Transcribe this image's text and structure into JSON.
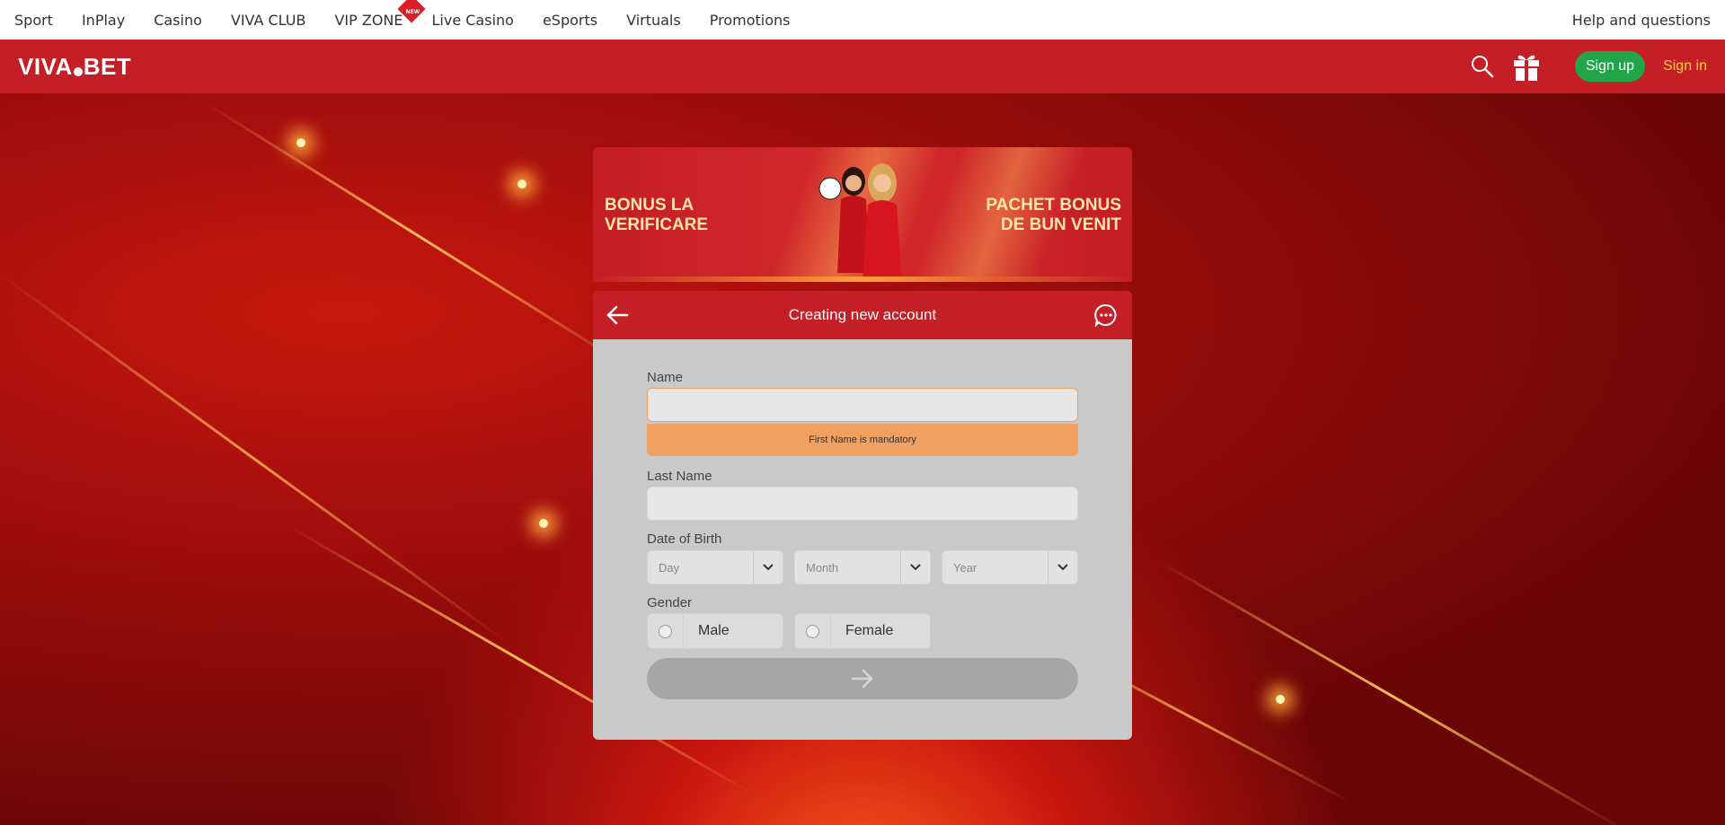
{
  "topnav": {
    "items": [
      "Sport",
      "InPlay",
      "Casino",
      "VIVA CLUB",
      "VIP ZONE",
      "Live Casino",
      "eSports",
      "Virtuals",
      "Promotions"
    ],
    "new_badge": "NEW",
    "help": "Help and questions"
  },
  "header": {
    "logo_left": "VIVA",
    "logo_right": "BET",
    "signup": "Sign up",
    "signin": "Sign in"
  },
  "banner": {
    "left_line1": "BONUS LA",
    "left_line2": "VERIFICARE",
    "right_line1": "PACHET BONUS",
    "right_line2": "DE BUN VENIT"
  },
  "form": {
    "title": "Creating new account",
    "name_label": "Name",
    "name_value": "",
    "name_error": "First Name is mandatory",
    "lastname_label": "Last Name",
    "lastname_value": "",
    "dob_label": "Date of Birth",
    "day_placeholder": "Day",
    "month_placeholder": "Month",
    "year_placeholder": "Year",
    "gender_label": "Gender",
    "male": "Male",
    "female": "Female"
  },
  "colors": {
    "brand_red": "#c41e26",
    "signup_green": "#21a44a",
    "signin_yellow": "#ffd23c",
    "error_orange": "#f0a060"
  },
  "icons": [
    "search-icon",
    "gift-icon",
    "back-arrow-icon",
    "chat-icon",
    "chevron-down-icon",
    "arrow-right-icon"
  ]
}
